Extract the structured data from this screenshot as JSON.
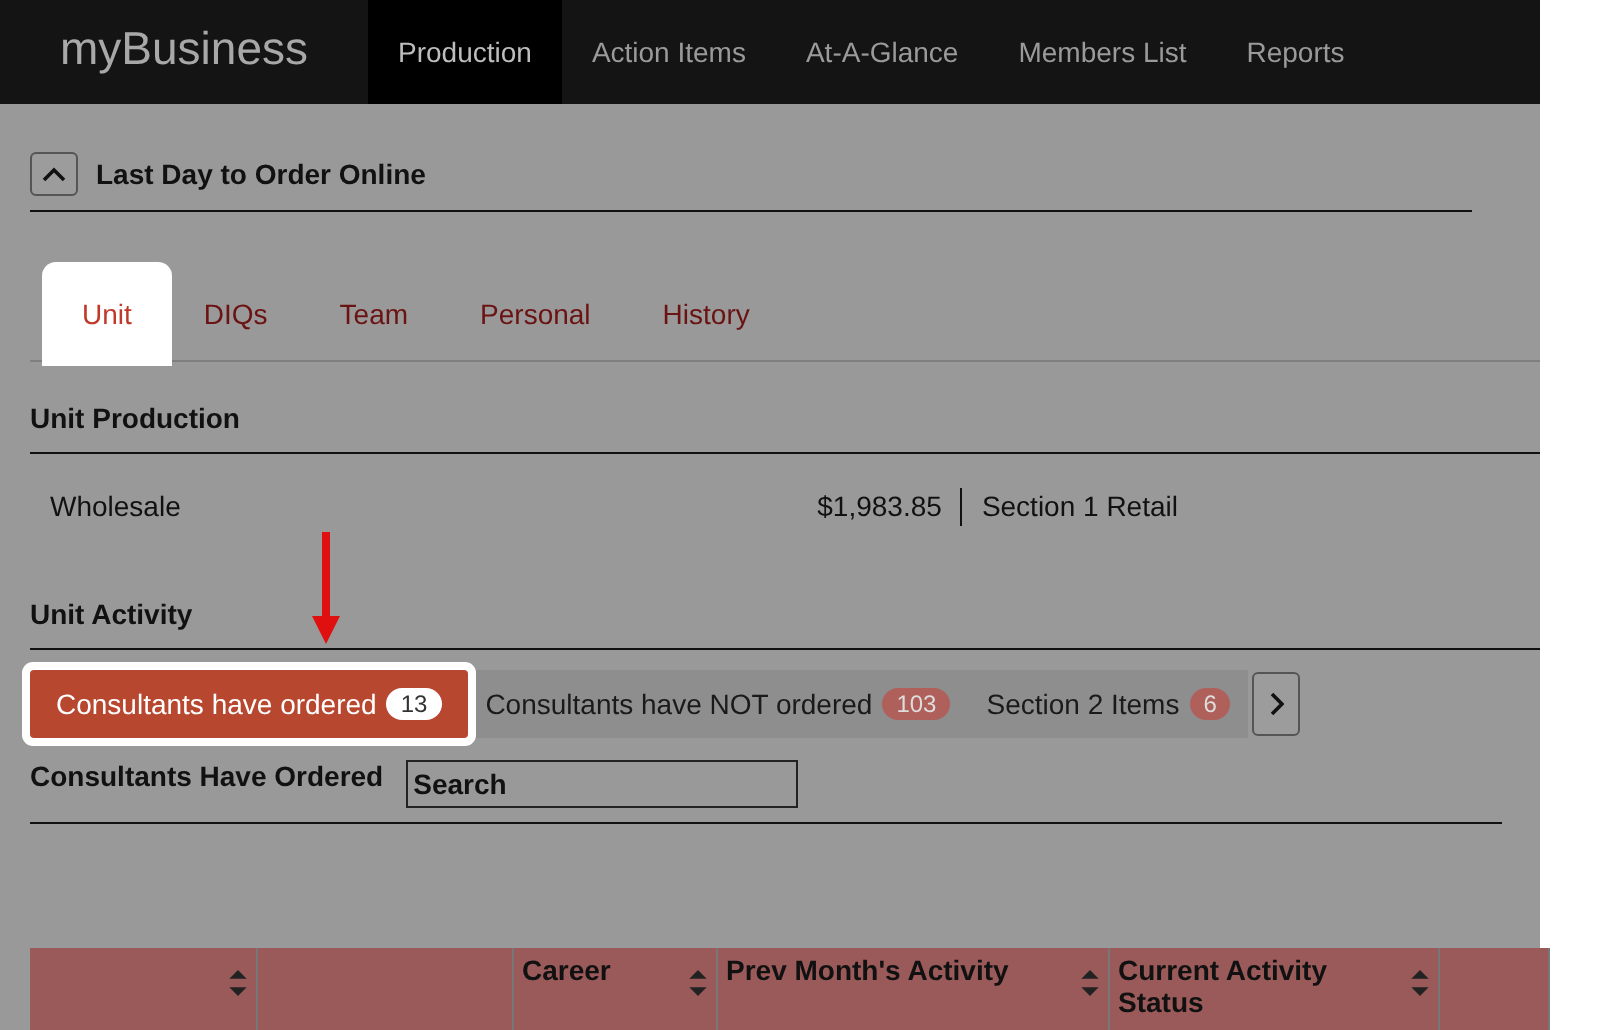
{
  "brand": "myBusiness",
  "nav": [
    {
      "label": "Production",
      "selected": true
    },
    {
      "label": "Action Items",
      "selected": false
    },
    {
      "label": "At-A-Glance",
      "selected": false
    },
    {
      "label": "Members List",
      "selected": false
    },
    {
      "label": "Reports",
      "selected": false
    }
  ],
  "notice": {
    "title": "Last Day to Order Online",
    "expanded": true
  },
  "tabs": [
    {
      "label": "Unit",
      "selected": true
    },
    {
      "label": "DIQs",
      "selected": false
    },
    {
      "label": "Team",
      "selected": false
    },
    {
      "label": "Personal",
      "selected": false
    },
    {
      "label": "History",
      "selected": false
    }
  ],
  "production": {
    "heading": "Unit Production",
    "label": "Wholesale",
    "amount": "$1,983.85",
    "next_label": "Section 1 Retail"
  },
  "activity": {
    "heading": "Unit Activity",
    "pills": [
      {
        "label": "Consultants have ordered",
        "count": "13",
        "selected": true
      },
      {
        "label": "Consultants have NOT ordered",
        "count": "103",
        "selected": false
      },
      {
        "label": "Section 2 Items",
        "count": "6",
        "selected": false
      }
    ]
  },
  "list": {
    "heading": "Consultants Have Ordered",
    "search": {
      "value": "Search"
    }
  },
  "table": {
    "columns": [
      {
        "sortable": true
      },
      {
        "sortable": false
      },
      {
        "label": "Career",
        "sortable": true
      },
      {
        "label": "Prev Month's Activity",
        "sortable": true
      },
      {
        "label": "Current Activity Status",
        "sortable": true
      },
      {
        "sortable": false
      }
    ]
  }
}
